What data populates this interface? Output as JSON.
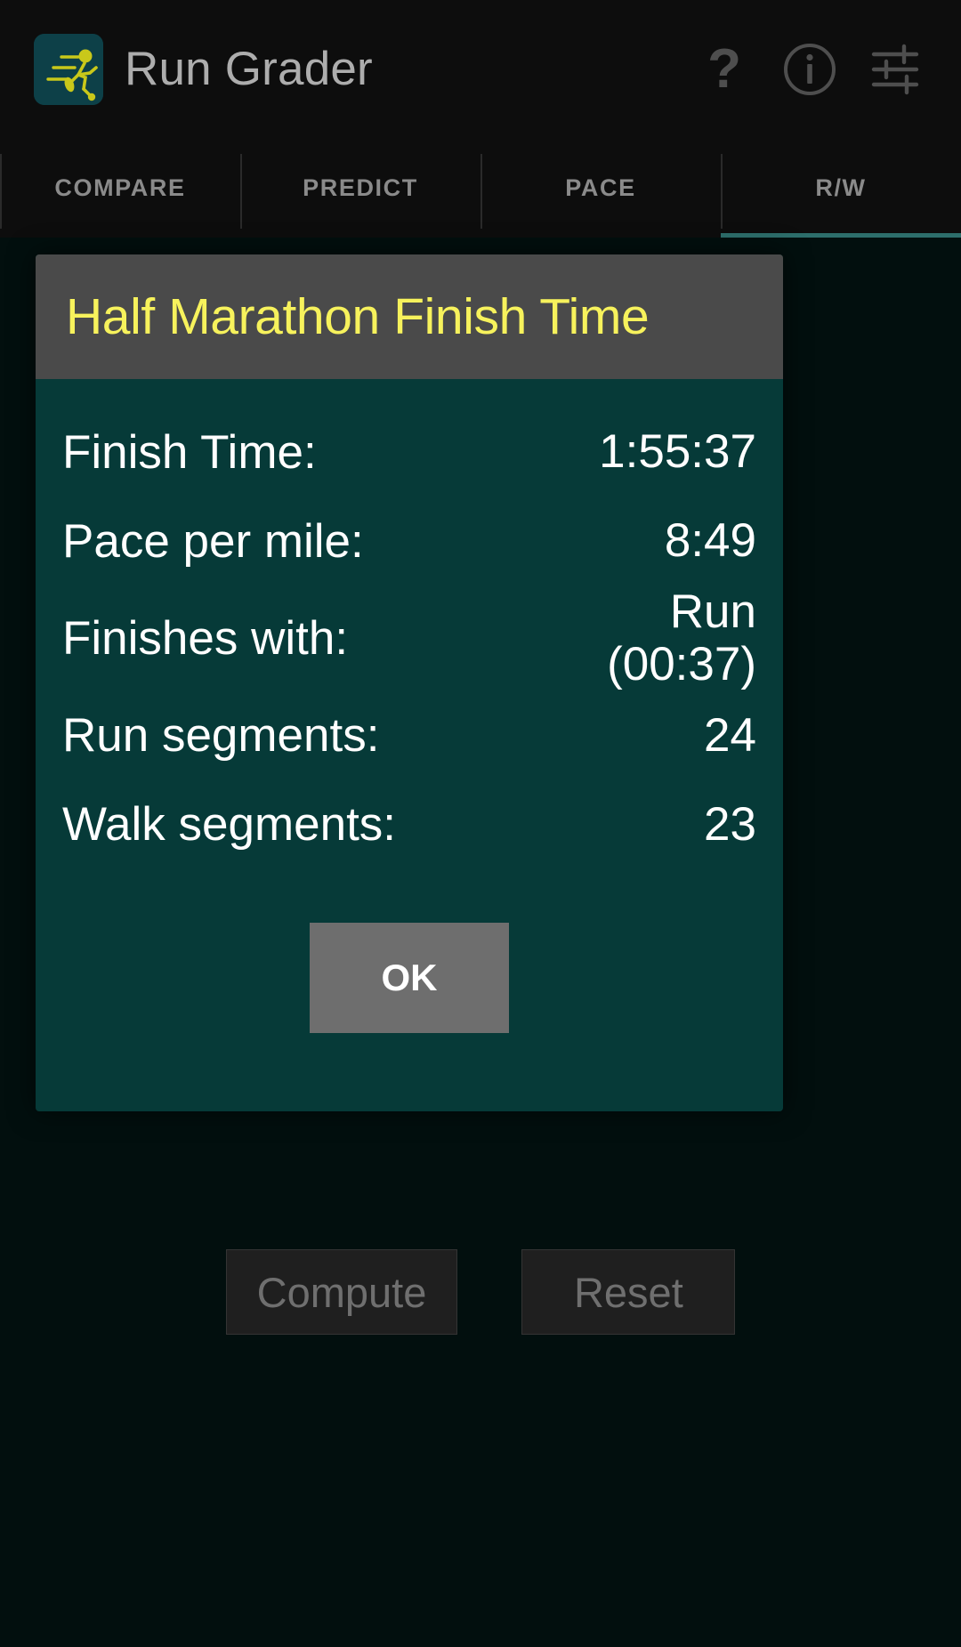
{
  "app": {
    "title": "Run Grader",
    "icon_name": "running-man-icon",
    "accent_color": "#2d6e6b",
    "title_color": "#adadad",
    "action_bar_color": "#0d0d0d"
  },
  "action_bar_icons": [
    {
      "name": "help-icon",
      "glyph": "?"
    },
    {
      "name": "info-icon",
      "glyph": "i"
    },
    {
      "name": "settings-sliders-icon",
      "glyph": "sliders"
    }
  ],
  "tabs": [
    {
      "label": "COMPARE",
      "active": false
    },
    {
      "label": "PREDICT",
      "active": false
    },
    {
      "label": "PACE",
      "active": false
    },
    {
      "label": "R/W",
      "active": true
    }
  ],
  "dialog": {
    "title": "Half Marathon Finish Time",
    "title_color": "#f7f25c",
    "title_bar_color": "#4a4a4a",
    "body_color": "#063a38",
    "rows": [
      {
        "label": "Finish Time:",
        "value": "1:55:37"
      },
      {
        "label": "Pace per mile:",
        "value": "8:49"
      },
      {
        "label": "Finishes with:",
        "value": "Run (00:37)"
      },
      {
        "label": "Run segments:",
        "value": "24"
      },
      {
        "label": "Walk segments:",
        "value": "23"
      }
    ],
    "ok_label": "OK"
  },
  "bottom_buttons": [
    {
      "label": "Compute"
    },
    {
      "label": "Reset"
    }
  ]
}
